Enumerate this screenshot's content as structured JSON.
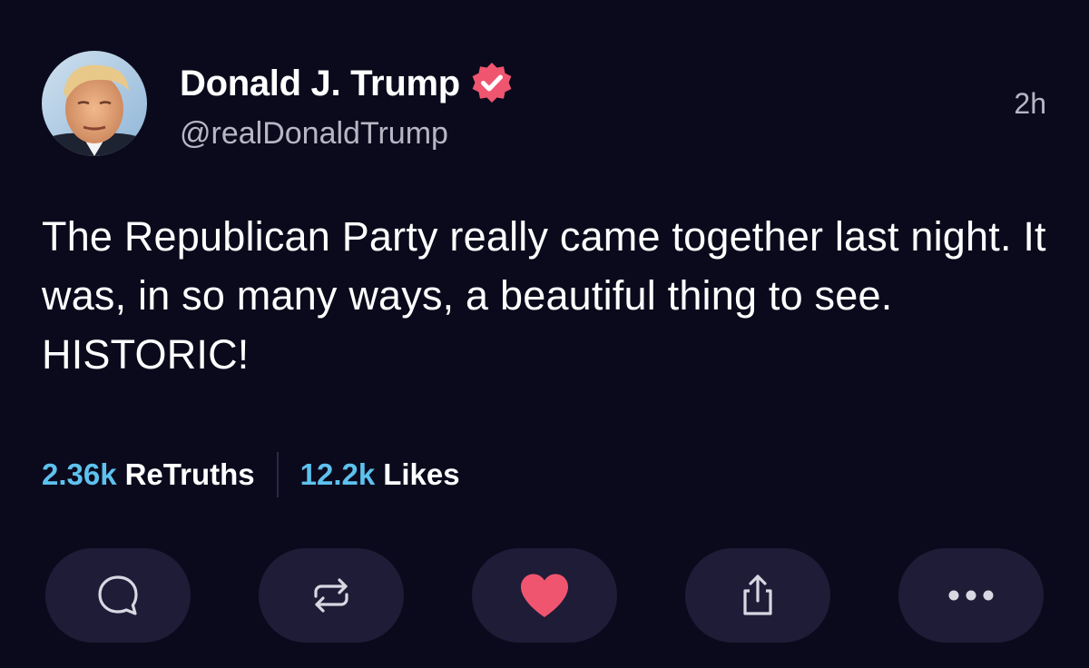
{
  "post": {
    "display_name": "Donald J. Trump",
    "handle": "@realDonaldTrump",
    "timestamp": "2h",
    "verified": true,
    "verified_badge_color": "#f0556f",
    "text": "The Republican Party really came together last night. It was, in so many ways, a beautiful thing to see. HISTORIC!"
  },
  "stats": {
    "retruths_count": "2.36k",
    "retruths_label": "ReTruths",
    "likes_count": "12.2k",
    "likes_label": "Likes"
  },
  "actions": [
    {
      "name": "reply",
      "icon": "chat-bubble-icon"
    },
    {
      "name": "retruth",
      "icon": "repost-arrows-icon"
    },
    {
      "name": "like",
      "icon": "heart-icon",
      "active": true
    },
    {
      "name": "share",
      "icon": "share-upload-icon"
    },
    {
      "name": "more",
      "icon": "ellipsis-icon"
    }
  ],
  "colors": {
    "background": "#0b0a1c",
    "button_background": "#1e1c37",
    "accent_count": "#5ec1ee",
    "like_active": "#f0556f",
    "secondary_text": "#b7b6c4"
  }
}
